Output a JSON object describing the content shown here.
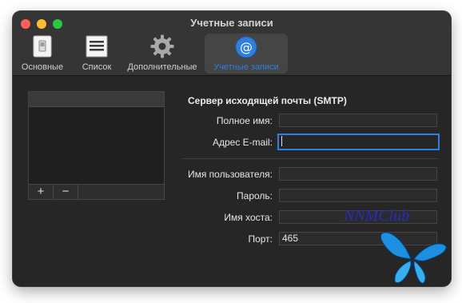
{
  "window": {
    "title": "Учетные записи"
  },
  "toolbar": {
    "items": [
      {
        "label": "Основные",
        "icon": "switch-icon"
      },
      {
        "label": "Список",
        "icon": "list-icon"
      },
      {
        "label": "Дополнительные",
        "icon": "gear-icon"
      },
      {
        "label": "Учетные записи",
        "icon": "at-sign-icon"
      }
    ],
    "selected": "Учетные записи"
  },
  "accounts": {
    "items": [],
    "add_label": "+",
    "remove_label": "−"
  },
  "smtp": {
    "heading": "Сервер исходящей почты (SMTP)",
    "full_name": {
      "label": "Полное имя:",
      "value": ""
    },
    "email": {
      "label": "Адрес E-mail:",
      "value": ""
    },
    "username": {
      "label": "Имя пользователя:",
      "value": ""
    },
    "password": {
      "label": "Пароль:",
      "value": ""
    },
    "host": {
      "label": "Имя хоста:",
      "value": ""
    },
    "port": {
      "label": "Порт:",
      "value": "465"
    }
  },
  "watermark": {
    "text": "NNMClub"
  },
  "colors": {
    "accent": "#2f7fe0",
    "window_bg": "#262626",
    "toolbar_bg": "#353535",
    "close": "#ff5f57",
    "minimize": "#febc2e",
    "zoom": "#28c840"
  }
}
